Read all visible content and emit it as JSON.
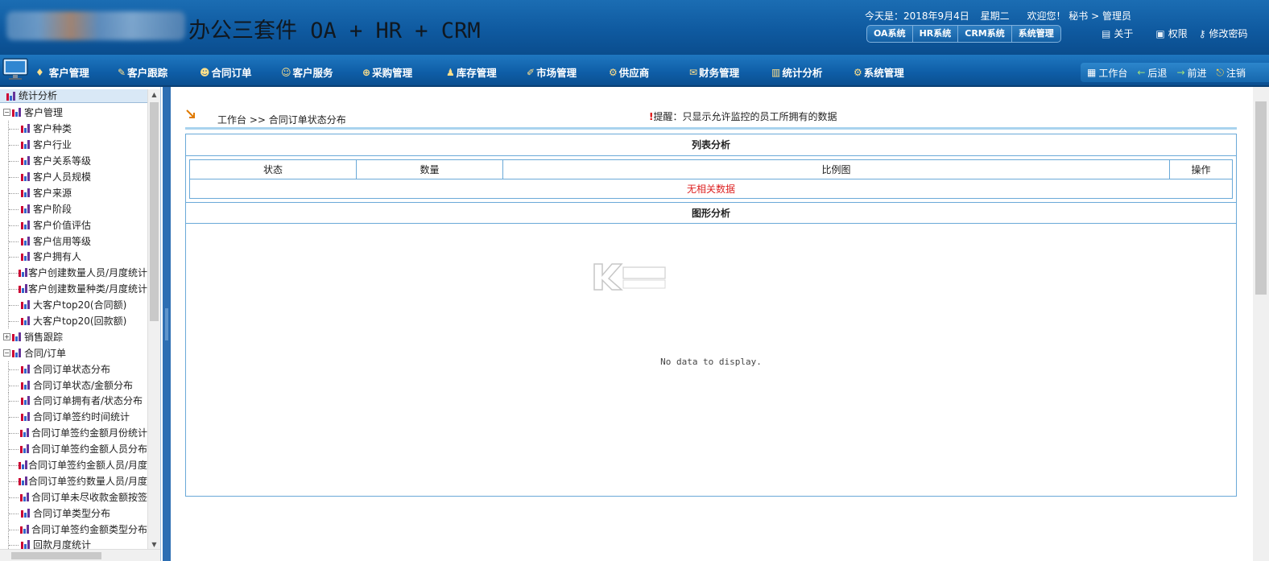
{
  "header": {
    "app_title": "办公三套件 OA + HR + CRM",
    "date_label": "今天是：2018年9月4日",
    "weekday": "星期二",
    "welcome": "欢迎您！ 秘书 > 管理员",
    "systems": [
      "OA系统",
      "HR系统",
      "CRM系统",
      "系统管理"
    ],
    "links": [
      {
        "label": "关于",
        "icon": "book-icon"
      },
      {
        "label": "权限",
        "icon": "lock-icon"
      },
      {
        "label": "修改密码",
        "icon": "key-icon"
      }
    ]
  },
  "nav": {
    "items": [
      "客户管理",
      "客户跟踪",
      "合同订单",
      "客户服务",
      "采购管理",
      "库存管理",
      "市场管理",
      "供应商",
      "财务管理",
      "统计分析",
      "系统管理"
    ],
    "right": [
      "工作台",
      "后退",
      "前进",
      "注销"
    ]
  },
  "sidebar": {
    "title": "统计分析",
    "groups": [
      {
        "label": "客户管理",
        "expanded": true,
        "items": [
          "客户种类",
          "客户行业",
          "客户关系等级",
          "客户人员规模",
          "客户来源",
          "客户阶段",
          "客户价值评估",
          "客户信用等级",
          "客户拥有人",
          "客户创建数量人员/月度统计",
          "客户创建数量种类/月度统计",
          "大客户top20(合同额)",
          "大客户top20(回款额)"
        ]
      },
      {
        "label": "销售跟踪",
        "expanded": false,
        "items": []
      },
      {
        "label": "合同/订单",
        "expanded": true,
        "items": [
          "合同订单状态分布",
          "合同订单状态/金额分布",
          "合同订单拥有者/状态分布",
          "合同订单签约时间统计",
          "合同订单签约金额月份统计",
          "合同订单签约金额人员分布",
          "合同订单签约金额人员/月度",
          "合同订单签约数量人员/月度",
          "合同订单未尽收款金额按签",
          "合同订单类型分布",
          "合同订单签约金额类型分布",
          "回款月度统计"
        ]
      }
    ]
  },
  "main": {
    "breadcrumb": "工作台 >> 合同订单状态分布",
    "notice_mark": "!",
    "notice": "提醒：只显示允许监控的员工所拥有的数据",
    "list_title": "列表分析",
    "columns": [
      "状态",
      "数量",
      "比例图",
      "操作"
    ],
    "empty_text": "无相关数据",
    "chart_title": "图形分析",
    "chart_empty": "No data to display."
  },
  "colors": {
    "header": "#0f5aa0",
    "accent": "#6aa9d8",
    "empty": "#dd2222"
  }
}
